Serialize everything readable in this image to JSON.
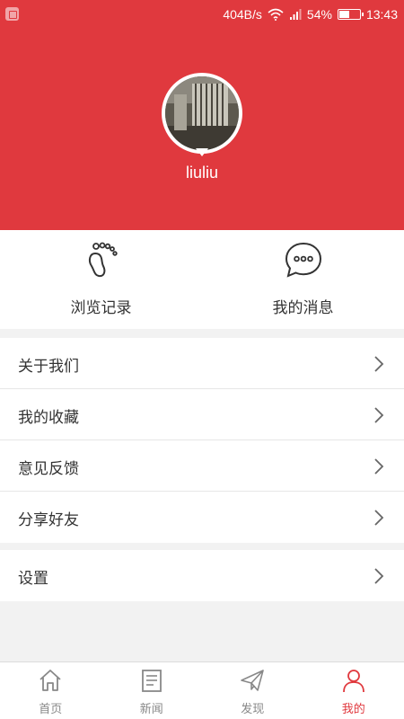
{
  "status_bar": {
    "speed": "404B/s",
    "battery": "54%",
    "battery_level": 0.54,
    "time": "13:43"
  },
  "profile": {
    "username": "liuliu"
  },
  "quick_actions": [
    {
      "label": "浏览记录",
      "icon": "footprint-icon"
    },
    {
      "label": "我的消息",
      "icon": "message-bubble-icon"
    }
  ],
  "menu_group_1": [
    {
      "label": "关于我们"
    },
    {
      "label": "我的收藏"
    },
    {
      "label": "意见反馈"
    },
    {
      "label": "分享好友"
    }
  ],
  "menu_group_2": [
    {
      "label": "设置"
    }
  ],
  "tabs": [
    {
      "label": "首页",
      "icon": "home-icon",
      "active": false
    },
    {
      "label": "新闻",
      "icon": "news-icon",
      "active": false
    },
    {
      "label": "发现",
      "icon": "paper-plane-icon",
      "active": false
    },
    {
      "label": "我的",
      "icon": "user-icon",
      "active": true
    }
  ],
  "colors": {
    "accent": "#e0393e",
    "text": "#333333",
    "muted": "#888888"
  }
}
